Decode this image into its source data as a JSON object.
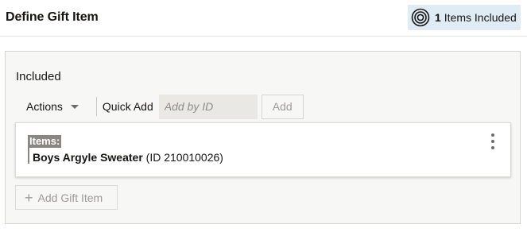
{
  "header": {
    "title": "Define Gift Item",
    "badge": {
      "icon": "target-icon",
      "count": "1",
      "label": "Items Included"
    }
  },
  "panel": {
    "title": "Included",
    "toolbar": {
      "actions_label": "Actions",
      "quick_add_label": "Quick Add",
      "quick_add_placeholder": "Add by ID",
      "add_label": "Add"
    },
    "items_card": {
      "items_label": "Items:",
      "item_name": "Boys Argyle Sweater",
      "item_id": "(ID 210010026)"
    },
    "add_gift_item_label": "Add Gift Item"
  },
  "colors": {
    "badge_background": "#dfecf5",
    "panel_background": "#f7f7f6",
    "items_label_background": "#8a8782"
  }
}
